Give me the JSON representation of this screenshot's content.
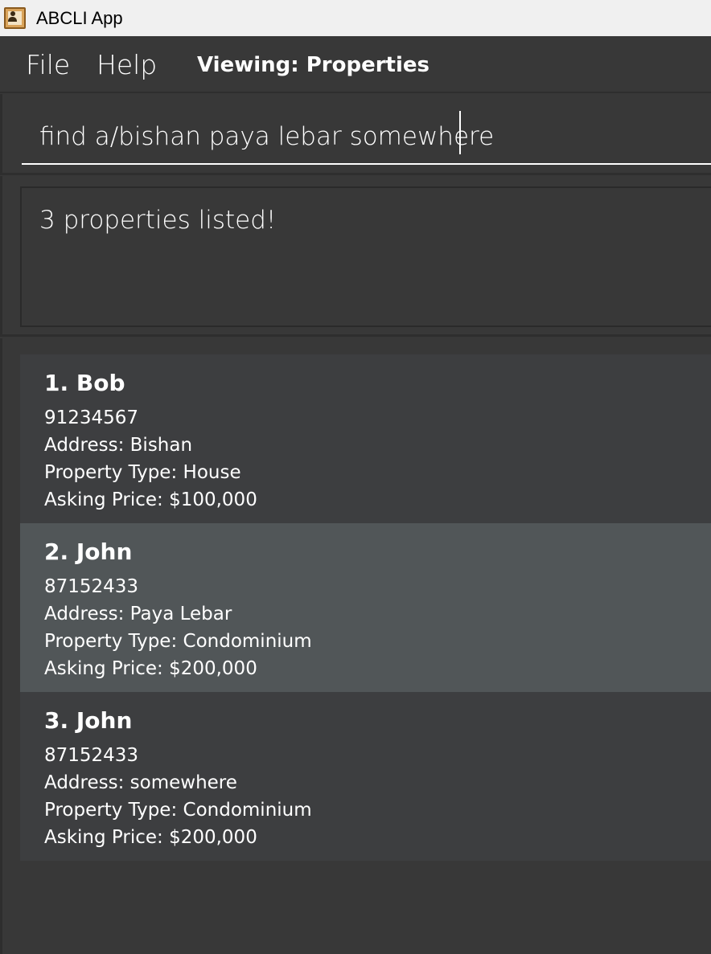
{
  "window": {
    "title": "ABCLI App",
    "icon": "contact-book-icon"
  },
  "menu": {
    "file": "File",
    "help": "Help",
    "viewing": "Viewing: Properties"
  },
  "command": {
    "value": "find a/bishan paya lebar somewhere"
  },
  "result": {
    "message": "3 properties listed!"
  },
  "properties": [
    {
      "name": "1. Bob",
      "phone": "91234567",
      "address": "Address: Bishan",
      "type": "Property Type: House",
      "price": "Asking Price: $100,000"
    },
    {
      "name": "2. John",
      "phone": "87152433",
      "address": "Address: Paya Lebar",
      "type": "Property Type: Condominium",
      "price": "Asking Price: $200,000"
    },
    {
      "name": "3. John",
      "phone": "87152433",
      "address": "Address: somewhere",
      "type": "Property Type: Condominium",
      "price": "Asking Price: $200,000"
    }
  ],
  "colors": {
    "background": "#383838",
    "card": "#3d3e40",
    "card_selected": "#515658",
    "text": "#ffffff"
  }
}
